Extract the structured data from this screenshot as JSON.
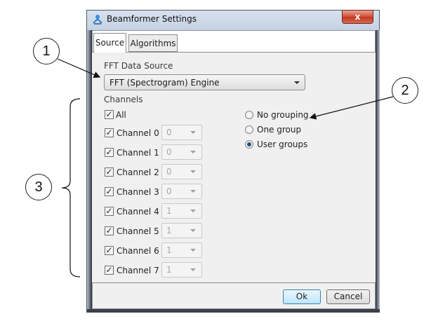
{
  "window": {
    "title": "Beamformer Settings",
    "close_glyph": "x"
  },
  "tabs": [
    {
      "label": "Source",
      "active": true
    },
    {
      "label": "Algorithms",
      "active": false
    }
  ],
  "source": {
    "fft_label": "FFT Data Source",
    "fft_value": "FFT (Spectrogram) Engine",
    "channels_label": "Channels",
    "all_label": "All",
    "all_checked": true,
    "channels": [
      {
        "label": "Channel 0",
        "checked": true,
        "group": "0"
      },
      {
        "label": "Channel 1",
        "checked": true,
        "group": "0"
      },
      {
        "label": "Channel 2",
        "checked": true,
        "group": "0"
      },
      {
        "label": "Channel 3",
        "checked": true,
        "group": "0"
      },
      {
        "label": "Channel 4",
        "checked": true,
        "group": "1"
      },
      {
        "label": "Channel 5",
        "checked": true,
        "group": "1"
      },
      {
        "label": "Channel 6",
        "checked": true,
        "group": "1"
      },
      {
        "label": "Channel 7",
        "checked": true,
        "group": "1"
      }
    ],
    "grouping": [
      {
        "label": "No grouping",
        "checked": false
      },
      {
        "label": "One group",
        "checked": false
      },
      {
        "label": "User groups",
        "checked": true
      }
    ]
  },
  "buttons": {
    "ok": "Ok",
    "cancel": "Cancel"
  },
  "callouts": {
    "one": "1",
    "two": "2",
    "three": "3"
  },
  "colors": {
    "radio_dot": "#1f4f8b",
    "ok_border": "#3c7fb1",
    "close_red": "#c23a22"
  }
}
